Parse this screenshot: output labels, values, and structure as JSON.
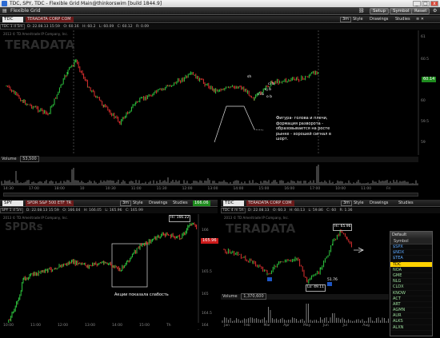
{
  "window": {
    "title": "TDC, SPY, TDC - Flexible Grid Main@thinkorswim [build 1844.9]",
    "btn_min": "_",
    "btn_max": "□",
    "btn_close": "x"
  },
  "menubar": {
    "app_label": "Flexible Grid",
    "buttons": [
      "Setup",
      "Symbol",
      "Reset"
    ],
    "icons": [
      "link-icon",
      "gear-icon",
      "grid-icon"
    ]
  },
  "top_chart": {
    "symbol": "TDC",
    "description": "TERADATA CORP COM",
    "period": "3m",
    "style_label": "Style",
    "drawings_label": "Drawings",
    "studies_label": "Studies",
    "quote_items": [
      "TDC 1 d 5m",
      "D: 22.08.13 15:59",
      "O: 60.16",
      "H: 60.2",
      "L: 60.09",
      "C: 60.12",
      "R: 0.09"
    ],
    "copyright": "2013 © TD Ameritrade IP Company, Inc.",
    "watermark": "TERADATA",
    "last_price": "60.14",
    "price_labels": [
      "61",
      "60.5",
      "60",
      "59.5",
      "59"
    ],
    "volume_label": "Volume",
    "volume_value": "53,500",
    "time_labels": [
      "14:30",
      "17:00",
      "18:00",
      "10",
      "10:30",
      "11:00",
      "11:30",
      "12:00",
      "13:00",
      "14:00",
      "15:00",
      "16:00",
      "17:00",
      "10:00",
      "11:00",
      "Fri"
    ],
    "pattern_labels": [
      "sh",
      "ci b",
      "cj b",
      "ci b",
      "o b"
    ],
    "annotation": "Фигура- голова и плечи, формация разворота - образовывается на росте рынке - хорошей сигнал в шорт."
  },
  "bottom_left": {
    "symbol": "SPY",
    "description": "SPDR S&P 500 ETF TR",
    "period": "3m",
    "style_label": "Style",
    "drawings_label": "Drawings",
    "studies_label": "Studies",
    "last_price_badge": "166.06",
    "quote_items": [
      "SPY 1 d 5m",
      "D: 22.08.13 15:59",
      "O: 166.04",
      "H: 166.05",
      "L: 165.96",
      "C: 165.99",
      "R: 0.09"
    ],
    "copyright": "2013 © TD Ameritrade IP Company, Inc.",
    "watermark": "SPDRs",
    "hi_label": "Hi: 166.22",
    "last_price": "165.96",
    "price_labels": [
      "166",
      "165.5",
      "165",
      "164.5",
      "164"
    ],
    "annotation": "Акции показала слабость",
    "time_labels": [
      "10:00",
      "11:00",
      "12:00",
      "13:00",
      "14:00",
      "15:00",
      "Th"
    ]
  },
  "bottom_right": {
    "symbol": "TDC",
    "description": "TERADATA CORP COM",
    "period": "3m",
    "style_label": "Style",
    "drawings_label": "Drawings",
    "studies_label": "Studies",
    "quote_items": [
      "TDC 4 m 5h",
      "D: 22.08.13",
      "O: 60.3",
      "H: 60.13",
      "L: 59.86",
      "C: 60",
      "R: 1.36"
    ],
    "copyright": "2013 © TD Ameritrade IP Company, Inc.",
    "watermark": "TERADATA",
    "hi_label": "Hi: 65.96",
    "lo_label": "Lo: 49.11",
    "mark_label": "51.76",
    "volume_label": "Volume",
    "volume_value": "1,370,600",
    "time_labels": [
      "Jan",
      "Feb",
      "Mar",
      "Apr",
      "May",
      "Jun",
      "Jul",
      "Aug"
    ]
  },
  "watchlist": {
    "title": "Default",
    "column": "Symbol",
    "items": [
      "$SPX",
      "$NDX",
      "$TEA",
      "TDC",
      "NOA",
      "GME",
      "NLG",
      "CLDX",
      "KNOW",
      "ACT",
      "ART",
      "AGMN",
      "AUR",
      "ALKS",
      "ALXN"
    ],
    "selected": "TDC"
  },
  "colors": {
    "up": "#2ecc40",
    "down": "#e03030",
    "accent": "#ffd200",
    "badge_red": "#cc1a1a",
    "badge_green": "#1e8c1e"
  }
}
